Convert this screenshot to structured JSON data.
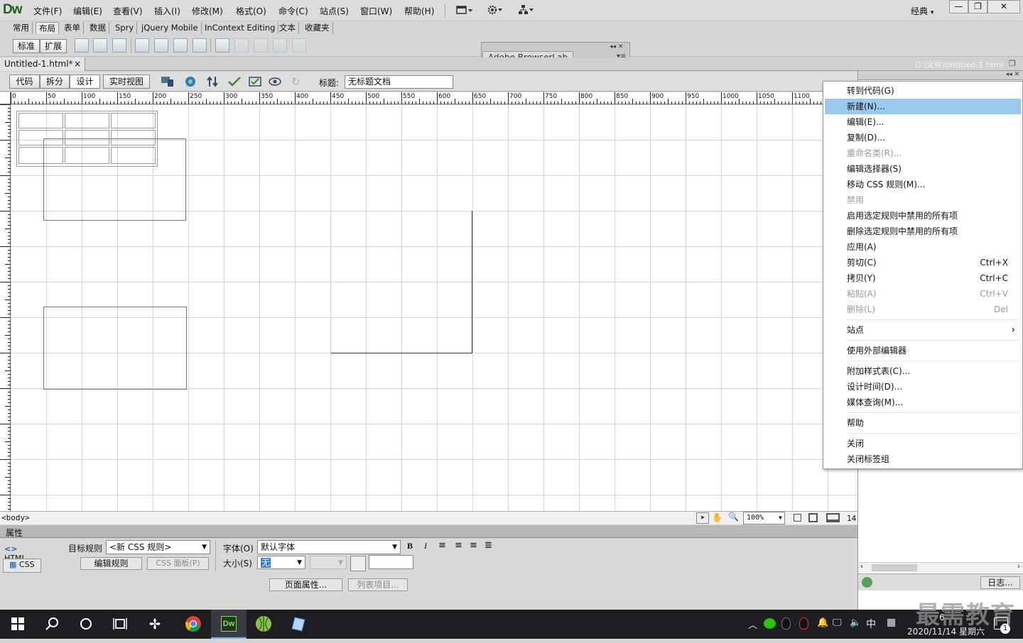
{
  "app": {
    "logo": "Dw",
    "workspace": "经典",
    "workspace_arrow": "▾"
  },
  "menu": [
    "文件(F)",
    "编辑(E)",
    "查看(V)",
    "插入(I)",
    "修改(M)",
    "格式(O)",
    "命令(C)",
    "站点(S)",
    "窗口(W)",
    "帮助(H)"
  ],
  "window_controls": {
    "min": "—",
    "max": "❐",
    "close": "✕"
  },
  "insert_tabs": [
    "常用",
    "布局",
    "表单",
    "数据",
    "Spry",
    "jQuery Mobile",
    "InContext Editing",
    "文本",
    "收藏夹"
  ],
  "insert_active": "布局",
  "layout_modes": {
    "standard": "标准",
    "expanded": "扩展"
  },
  "browserlab": {
    "title": "Adobe BrowserLab"
  },
  "document": {
    "tab_label": "Untitled-1.html*",
    "close": "×",
    "path": "D:\\文件\\Untitled-1.html"
  },
  "view_buttons": {
    "code": "代码",
    "split": "拆分",
    "design": "设计",
    "live": "实时视图"
  },
  "title_field": {
    "label": "标题:",
    "value": "无标题文档"
  },
  "ruler_labels": [
    "0",
    "50",
    "100",
    "150",
    "200",
    "250",
    "300",
    "350",
    "400",
    "450",
    "500",
    "550",
    "600",
    "650",
    "700",
    "750",
    "800",
    "850",
    "900",
    "950",
    "1000",
    "1050",
    "1100"
  ],
  "status": {
    "tag": "<body>",
    "zoom": "100%",
    "size": "14:"
  },
  "properties": {
    "header": "属性",
    "html_btn": "HTML",
    "css_btn": "CSS",
    "target_rule_label": "目标规则",
    "target_rule_value": "<新 CSS 规则>",
    "edit_rule": "编辑规则",
    "css_panel": "CSS 面板(P)",
    "font_label": "字体(O)",
    "font_value": "默认字体",
    "size_label": "大小(S)",
    "size_value": "无",
    "page_props": "页面属性...",
    "list_items": "列表项目..."
  },
  "right_panel": {
    "log_btn": "日志..."
  },
  "context_menu": {
    "items": [
      {
        "label": "转到代码(G)",
        "shortcut": "",
        "disabled": false
      },
      {
        "label": "新建(N)...",
        "shortcut": "",
        "disabled": false,
        "highlighted": true
      },
      {
        "label": "编辑(E)...",
        "shortcut": "",
        "disabled": false
      },
      {
        "label": "复制(D)...",
        "shortcut": "",
        "disabled": false
      },
      {
        "label": "重命名类(R)...",
        "shortcut": "",
        "disabled": true
      },
      {
        "label": "编辑选择器(S)",
        "shortcut": "",
        "disabled": false
      },
      {
        "label": "移动 CSS 规则(M)...",
        "shortcut": "",
        "disabled": false
      },
      {
        "label": "禁用",
        "shortcut": "",
        "disabled": true
      },
      {
        "label": "启用选定规则中禁用的所有项",
        "shortcut": "",
        "disabled": false
      },
      {
        "label": "删除选定规则中禁用的所有项",
        "shortcut": "",
        "disabled": false
      },
      {
        "label": "应用(A)",
        "shortcut": "",
        "disabled": false
      },
      {
        "label": "剪切(C)",
        "shortcut": "Ctrl+X",
        "disabled": false
      },
      {
        "label": "拷贝(Y)",
        "shortcut": "Ctrl+C",
        "disabled": false
      },
      {
        "label": "粘贴(A)",
        "shortcut": "Ctrl+V",
        "disabled": true
      },
      {
        "label": "删除(L)",
        "shortcut": "Del",
        "disabled": true
      },
      {
        "label": "站点",
        "shortcut": "",
        "disabled": false,
        "submenu": true
      },
      {
        "label": "使用外部编辑器",
        "shortcut": "",
        "disabled": false
      },
      {
        "label": "附加样式表(C)...",
        "shortcut": "",
        "disabled": false
      },
      {
        "label": "设计时间(D)...",
        "shortcut": "",
        "disabled": false
      },
      {
        "label": "媒体查询(M)...",
        "shortcut": "",
        "disabled": false
      },
      {
        "label": "帮助",
        "shortcut": "",
        "disabled": false
      },
      {
        "label": "关闭",
        "shortcut": "",
        "disabled": false
      },
      {
        "label": "关闭标签组",
        "shortcut": "",
        "disabled": false
      }
    ],
    "submenu_arrow": "›"
  },
  "taskbar": {
    "ime": "中",
    "date": "2020/11/14 星期六",
    "time": "6",
    "notif_count": "1",
    "watermark": "最需教育",
    "dw_icon": "Dw"
  },
  "colors": {
    "highlight": "#99c9ef",
    "grid": "#d7dcae",
    "taskbar": "#1d1d22",
    "dw_green": "#1b5e20"
  }
}
